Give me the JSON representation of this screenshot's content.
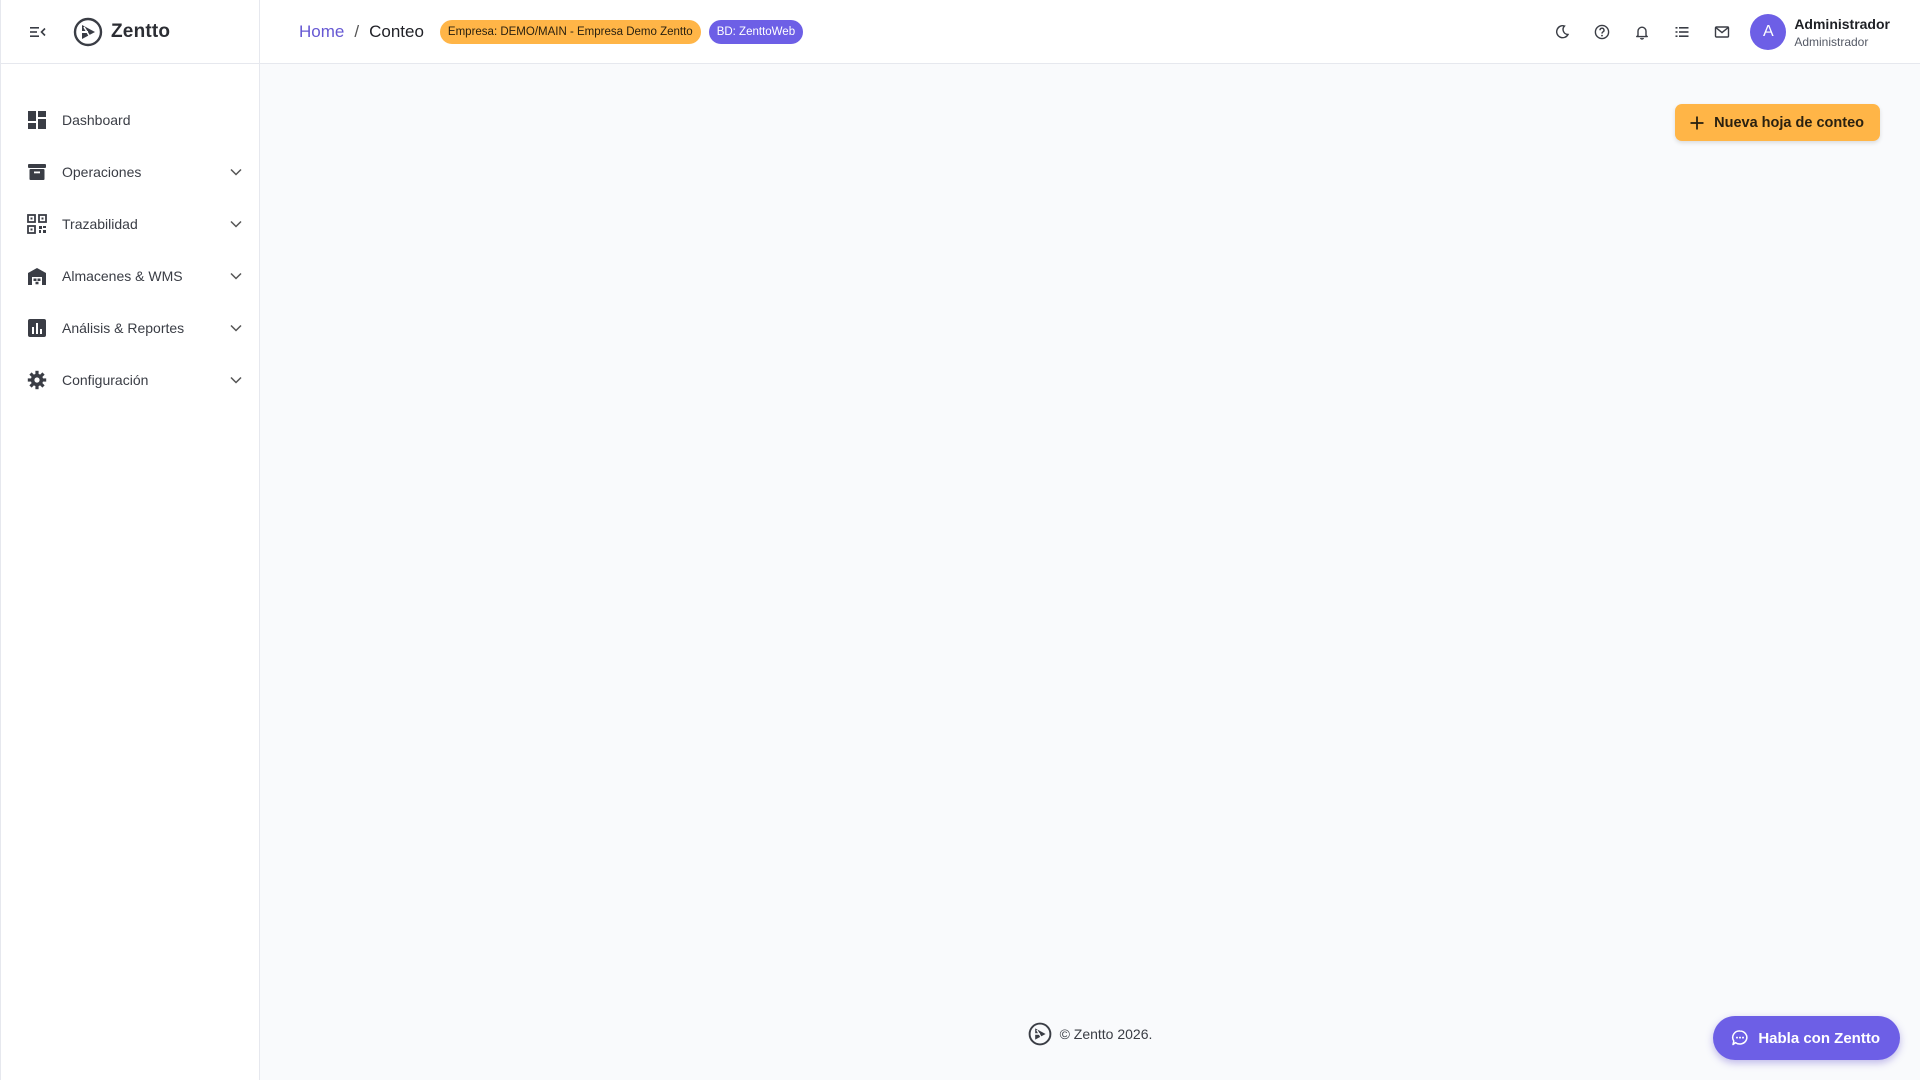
{
  "app": {
    "name": "Zentto"
  },
  "sidebar": {
    "items": [
      {
        "label": "Dashboard",
        "icon": "dashboard-icon",
        "has_submenu": false
      },
      {
        "label": "Operaciones",
        "icon": "archive-icon",
        "has_submenu": true
      },
      {
        "label": "Trazabilidad",
        "icon": "qr-code-icon",
        "has_submenu": true
      },
      {
        "label": "Almacenes & WMS",
        "icon": "warehouse-icon",
        "has_submenu": true
      },
      {
        "label": "Análisis & Reportes",
        "icon": "bar-chart-icon",
        "has_submenu": true
      },
      {
        "label": "Configuración",
        "icon": "gear-icon",
        "has_submenu": true
      }
    ]
  },
  "header": {
    "breadcrumb": {
      "home": "Home",
      "separator": "/",
      "current": "Conteo"
    },
    "company_chip": "Empresa: DEMO/MAIN - Empresa Demo Zentto",
    "db_chip": "BD: ZenttoWeb",
    "actions": [
      "moon-icon",
      "help-icon",
      "bell-icon",
      "list-icon",
      "mail-icon"
    ],
    "user": {
      "initial": "A",
      "name": "Administrador",
      "role": "Administrador"
    }
  },
  "main": {
    "new_sheet_label": "Nueva hoja de conteo"
  },
  "footer": {
    "copyright": "© Zentto 2026."
  },
  "chat": {
    "label": "Habla con Zentto"
  },
  "colors": {
    "primary": "#6d5fe6",
    "accent": "#ffb547",
    "background": "#f9fafc"
  }
}
